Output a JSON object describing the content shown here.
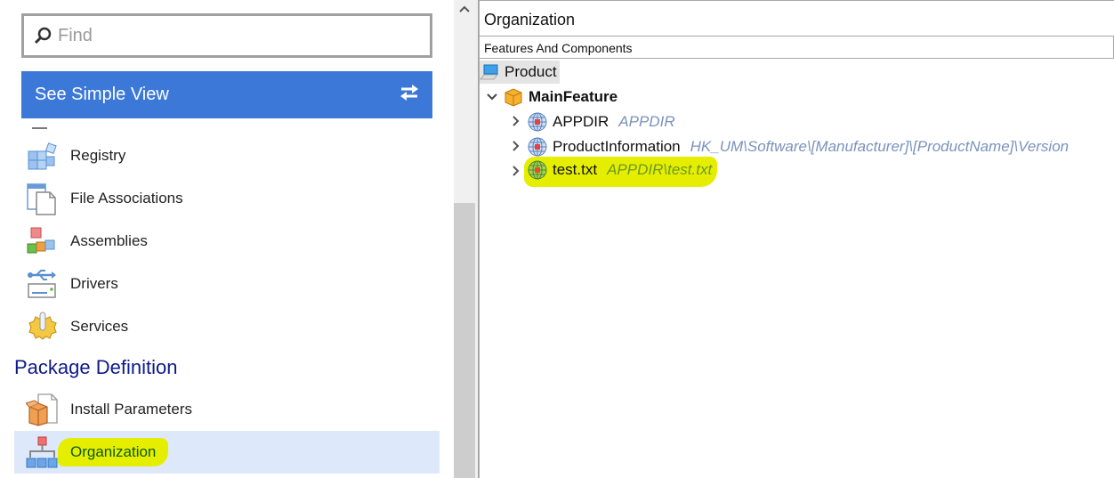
{
  "left_panel": {
    "find": {
      "placeholder": "Find",
      "value": ""
    },
    "simple_view_button": {
      "label": "See Simple View",
      "icon": "swap-arrows-icon"
    },
    "nav_items": [
      {
        "label": "Registry",
        "icon": "registry-cubes-icon"
      },
      {
        "label": "File Associations",
        "icon": "file-associations-icon"
      },
      {
        "label": "Assemblies",
        "icon": "assemblies-icon"
      },
      {
        "label": "Drivers",
        "icon": "usb-driver-icon"
      },
      {
        "label": "Services",
        "icon": "gear-service-icon"
      }
    ],
    "section_title": "Package Definition",
    "package_items": [
      {
        "label": "Install Parameters",
        "icon": "install-package-icon"
      },
      {
        "label": "Organization",
        "icon": "org-chart-icon",
        "selected": true,
        "highlighted": true
      }
    ]
  },
  "right_panel": {
    "title": "Organization",
    "tab": "Features And Components",
    "tree": {
      "root": {
        "label": "Product",
        "icon": "computer-icon"
      },
      "feature": {
        "label": "MainFeature",
        "icon": "box-icon",
        "expanded": true
      },
      "components": [
        {
          "label": "APPDIR",
          "detail": "APPDIR",
          "icon": "globe-component-icon"
        },
        {
          "label": "ProductInformation",
          "detail": "HK_UM\\Software\\[Manufacturer]\\[ProductName]\\Version",
          "icon": "globe-component-icon"
        },
        {
          "label": "test.txt",
          "detail": "APPDIR\\test.txt",
          "icon": "globe-component-icon",
          "highlighted": true
        }
      ]
    }
  },
  "colors": {
    "accent_blue": "#3c78d8",
    "section_title": "#0c1a8c",
    "selected_bg": "#dde9fb",
    "highlight_yellow": "#e6ee00",
    "detail_text": "#7a92bc"
  }
}
